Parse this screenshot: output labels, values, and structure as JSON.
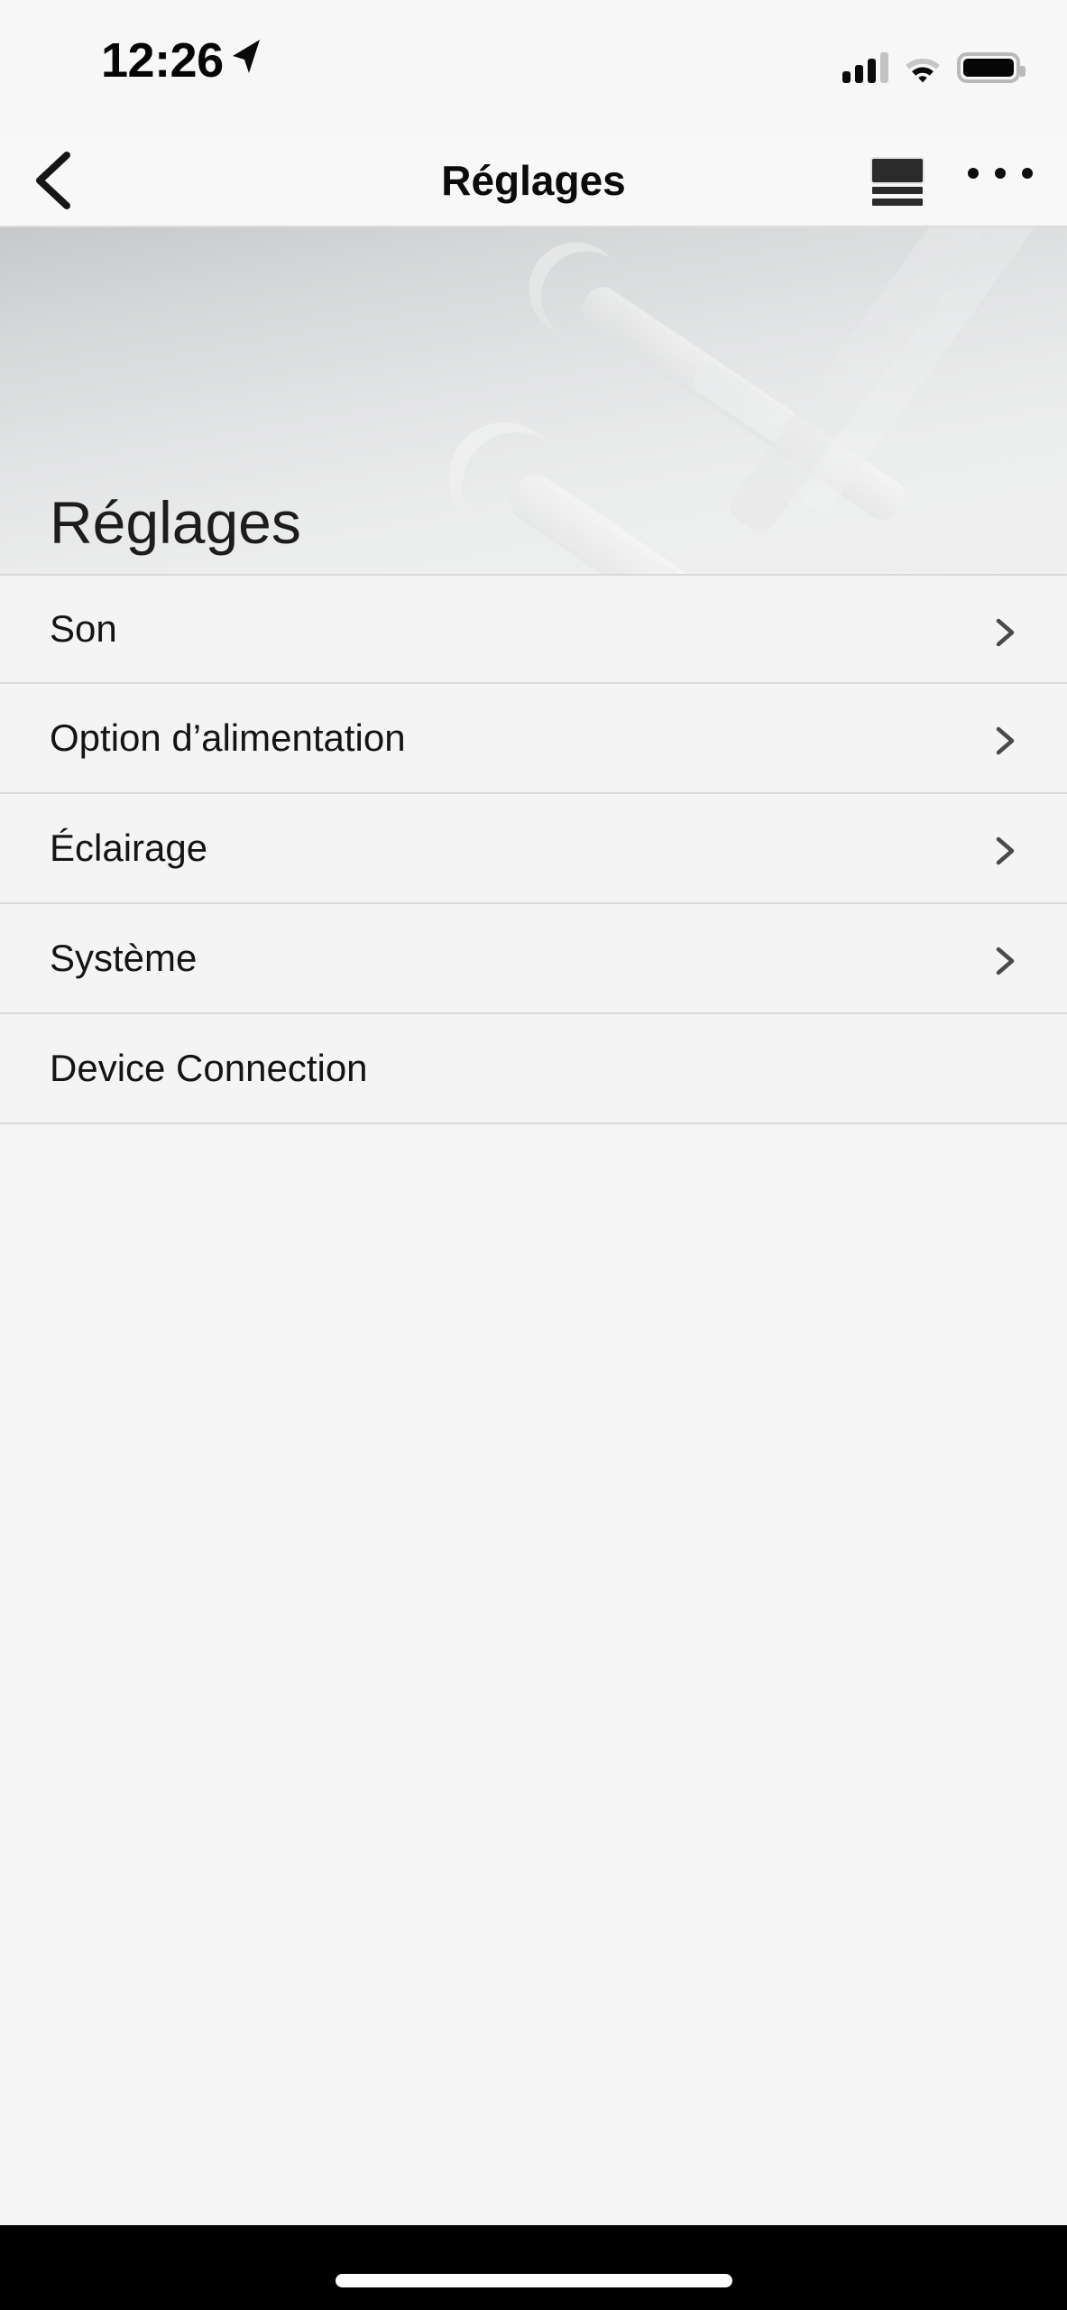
{
  "status_bar": {
    "time": "12:26",
    "location_icon": "location-arrow-icon",
    "cellular_icon": "cellular-signal-icon",
    "cellular_bars_filled": 3,
    "cellular_bars_total": 4,
    "wifi_icon": "wifi-icon",
    "battery_icon": "battery-full-icon"
  },
  "nav_bar": {
    "back_icon": "chevron-left-icon",
    "title": "Réglages",
    "reader_icon": "reader-view-icon",
    "more_icon": "more-horizontal-icon"
  },
  "hero": {
    "title": "Réglages",
    "image_alt": "wrenches-photo"
  },
  "list": {
    "rows": [
      {
        "label": "Son",
        "chevron": true,
        "chevron_icon": "chevron-right-icon"
      },
      {
        "label": "Option d’alimentation",
        "chevron": true,
        "chevron_icon": "chevron-right-icon"
      },
      {
        "label": "Éclairage",
        "chevron": true,
        "chevron_icon": "chevron-right-icon"
      },
      {
        "label": "Système",
        "chevron": true,
        "chevron_icon": "chevron-right-icon"
      },
      {
        "label": "Device Connection",
        "chevron": false,
        "chevron_icon": ""
      }
    ]
  },
  "bottom": {
    "home_indicator": "home-indicator"
  },
  "colors": {
    "background": "#f4f4f4",
    "status_bar_bg": "#f7f7f7",
    "nav_bar_bg": "#f8f8f8",
    "separator": "#d9d9d9",
    "text_primary": "#141414",
    "chevron": "#4a4a4a",
    "home_bar_bg": "#000000"
  }
}
